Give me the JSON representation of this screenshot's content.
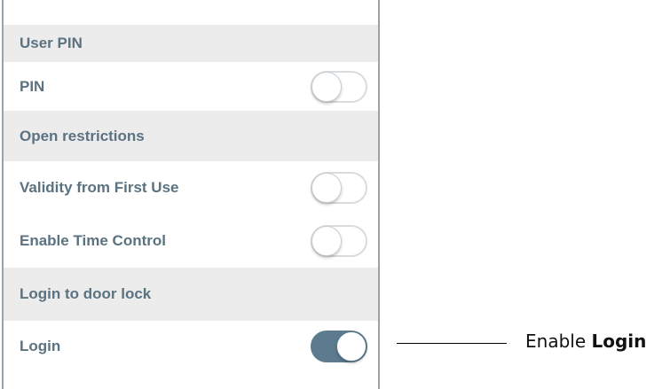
{
  "sections": {
    "user_pin": {
      "header": "User PIN",
      "rows": [
        {
          "label": "PIN",
          "enabled": false
        }
      ]
    },
    "open_restrictions": {
      "header": "Open restrictions",
      "rows": [
        {
          "label": "Validity from First Use",
          "enabled": false
        },
        {
          "label": "Enable Time Control",
          "enabled": false
        }
      ]
    },
    "login_to_door_lock": {
      "header": "Login to door lock",
      "rows": [
        {
          "label": "Login",
          "enabled": true
        }
      ]
    }
  },
  "callout": {
    "prefix": "Enable ",
    "emphasis": "Login"
  },
  "colors": {
    "label_text": "#5b7281",
    "section_background": "#ececec",
    "toggle_on": "#5c7b8e",
    "toggle_off_border": "#d9dcdf",
    "panel_border": "#9aa3aa"
  }
}
